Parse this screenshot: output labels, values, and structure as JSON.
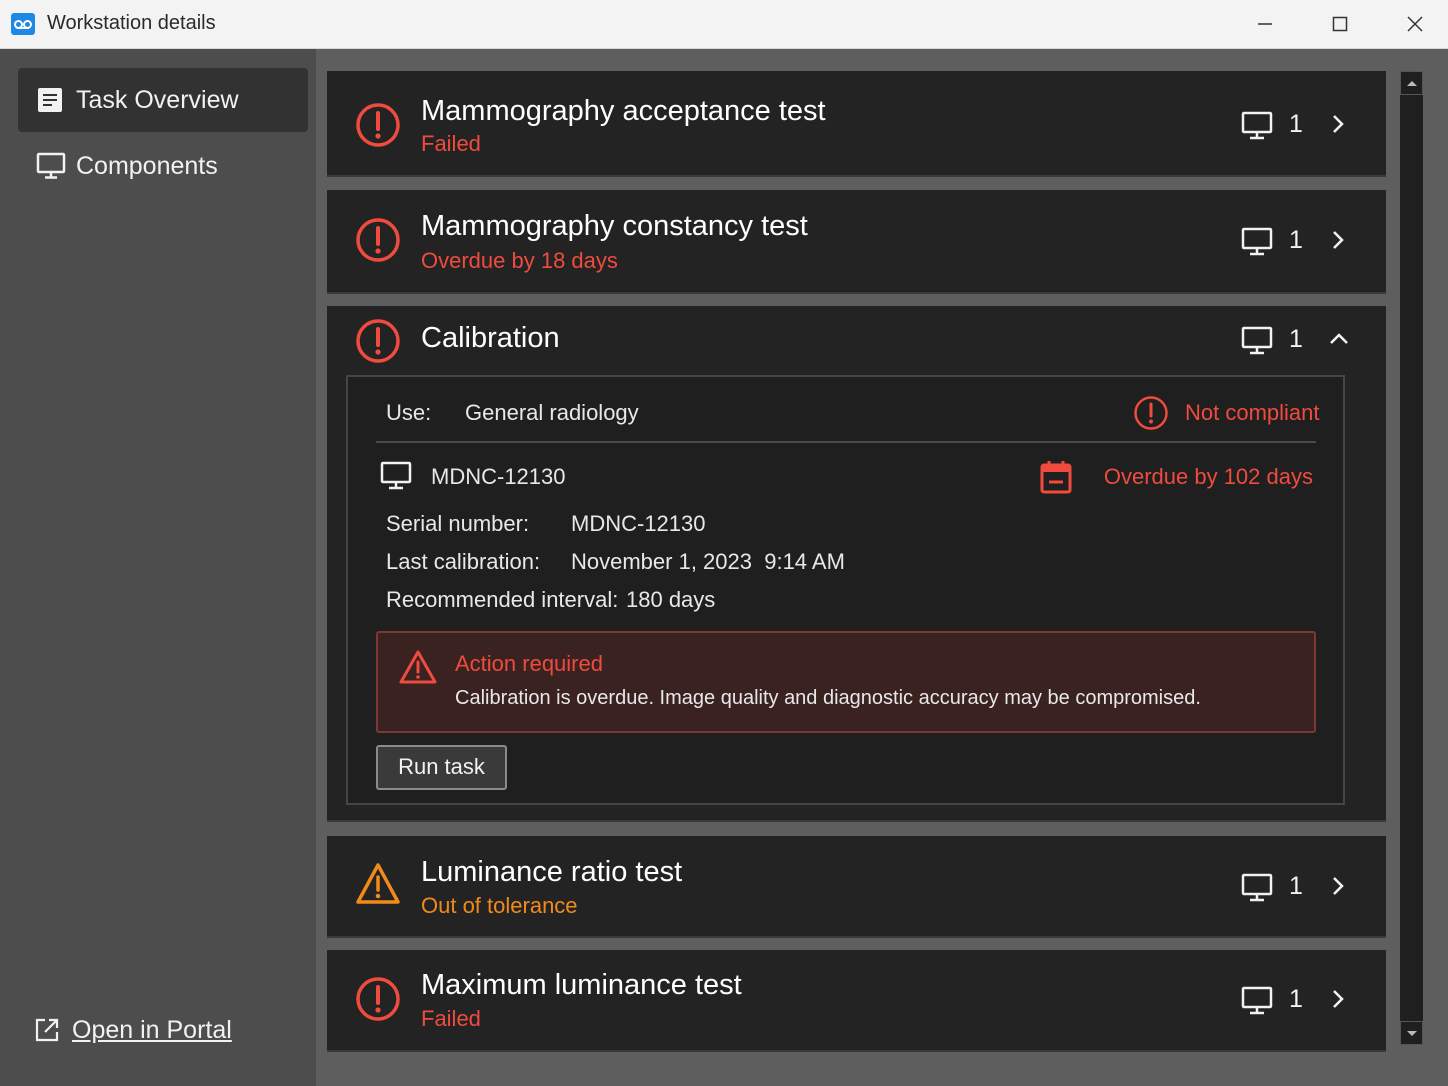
{
  "window": {
    "title": "Workstation details",
    "icon": "app-logo-icon"
  },
  "sidebar": {
    "items": [
      {
        "label": "Task Overview",
        "icon": "document-icon",
        "active": true
      },
      {
        "label": "Components",
        "icon": "monitor-icon",
        "active": false
      }
    ],
    "portal_link": "Open in Portal"
  },
  "tasks": [
    {
      "title": "Mammography acceptance test",
      "status": "Failed",
      "status_color": "#ef4b3f",
      "icon": "error-circle-icon",
      "count": "1",
      "expanded": false
    },
    {
      "title": "Mammography constancy test",
      "status": "Overdue by 18 days",
      "status_color": "#ef4b3f",
      "icon": "error-circle-icon",
      "count": "1",
      "expanded": false
    },
    {
      "title": "Calibration",
      "status": "",
      "status_color": "#ef4b3f",
      "icon": "error-circle-icon",
      "count": "1",
      "expanded": true
    },
    {
      "title": "Luminance ratio test",
      "status": "Out of tolerance",
      "status_color": "#f28a1b",
      "icon": "warning-triangle-icon",
      "count": "1",
      "expanded": false
    },
    {
      "title": "Maximum luminance test",
      "status": "Failed",
      "status_color": "#ef4b3f",
      "icon": "error-circle-icon",
      "count": "1",
      "expanded": false
    }
  ],
  "calibration_detail": {
    "use_label": "Use:",
    "use_value": "General radiology",
    "compliance": "Not compliant",
    "component": "MDNC-12130",
    "overdue": "Overdue by 102 days",
    "serial_label": "Serial number:",
    "serial_value": "MDNC-12130",
    "last_cal_label": "Last calibration:",
    "last_cal_value": "November 1, 2023  9:14 AM",
    "interval_label": "Recommended interval:",
    "interval_value": "180 days",
    "alert_title": "Action required",
    "alert_message": "Calibration is overdue. Image quality and diagnostic accuracy may be compromised.",
    "run_button": "Run task"
  },
  "colors": {
    "accent_red": "#ef4b3f",
    "accent_orange": "#f28a1b",
    "card_bg": "#232323"
  }
}
